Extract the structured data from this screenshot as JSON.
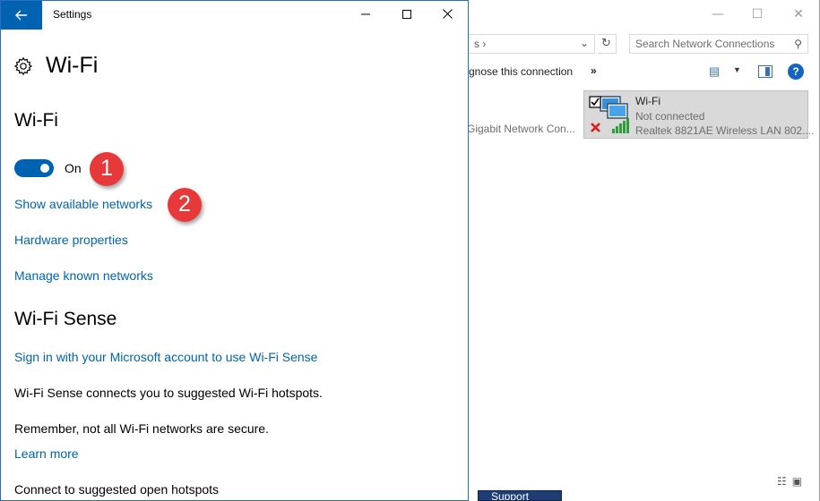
{
  "settings_window": {
    "title": "Settings",
    "back_icon": "arrow-left-icon",
    "minimize_glyph": "—",
    "maximize_glyph": "☐",
    "close_glyph": "✕",
    "page_title": "Wi-Fi",
    "page_icon": "gear-icon",
    "section_wifi": {
      "heading": "Wi-Fi",
      "toggle_state": "On",
      "toggle_on": true,
      "links": [
        "Show available networks",
        "Hardware properties",
        "Manage known networks"
      ]
    },
    "section_sense": {
      "heading": "Wi-Fi Sense",
      "sign_in_link": "Sign in with your Microsoft account to use Wi-Fi Sense",
      "desc1": "Wi-Fi Sense connects you to suggested Wi-Fi hotspots.",
      "desc2": "Remember, not all Wi-Fi networks are secure.",
      "learn_more": "Learn more",
      "open_hotspots": "Connect to suggested open hotspots"
    }
  },
  "callouts": [
    "1",
    "2"
  ],
  "network_window": {
    "breadcrumb_glyph": "s ›",
    "search_placeholder": "Search Network Connections",
    "cmd_diagnose": "gnose this connection",
    "cmd_more": "»",
    "ethernet_partial": "Gigabit Network Con...",
    "wifi_adapter": {
      "name": "Wi-Fi",
      "status": "Not connected",
      "device": "Realtek 8821AE Wireless LAN 802...."
    },
    "help_glyph": "?",
    "taskbar_partial": "Support"
  },
  "colors": {
    "accent": "#0063b1",
    "badge": "#e8393a"
  }
}
